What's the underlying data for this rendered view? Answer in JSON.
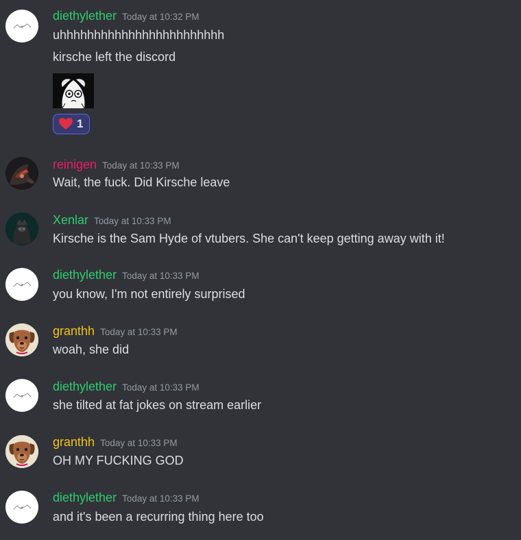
{
  "colors": {
    "background": "#313338",
    "text": "#dbdee1",
    "timestamp": "#949ba4",
    "user_green": "#2ecc71",
    "user_pink": "#e91e63",
    "user_yellow": "#f1c40f",
    "reaction_border": "#5865f2",
    "reaction_bg": "#373a6d"
  },
  "messages": [
    {
      "username": "diethylether",
      "timestamp": "Today at 10:32 PM",
      "avatar": "skeletal-formula-avatar",
      "lines": [
        "uhhhhhhhhhhhhhhhhhhhhhhhh",
        "kirsche left the discord"
      ],
      "attachment": "anime-girl-sketch-image",
      "reaction": {
        "emoji": "heart-emoji",
        "count": "1"
      }
    },
    {
      "username": "reinigen",
      "timestamp": "Today at 10:33 PM",
      "avatar": "dark-character-avatar",
      "lines": [
        "Wait, the fuck. Did Kirsche leave"
      ]
    },
    {
      "username": "Xenlar",
      "timestamp": "Today at 10:33 PM",
      "avatar": "dark-figure-avatar",
      "lines": [
        "Kirsche is the Sam Hyde of vtubers. She can't keep getting away with it!"
      ]
    },
    {
      "username": "diethylether",
      "timestamp": "Today at 10:33 PM",
      "avatar": "skeletal-formula-avatar",
      "lines": [
        "you know, I'm not entirely surprised"
      ]
    },
    {
      "username": "granthh",
      "timestamp": "Today at 10:33 PM",
      "avatar": "dog-avatar",
      "lines": [
        "woah, she did"
      ]
    },
    {
      "username": "diethylether",
      "timestamp": "Today at 10:33 PM",
      "avatar": "skeletal-formula-avatar",
      "lines": [
        "she tilted at fat jokes on stream earlier"
      ]
    },
    {
      "username": "granthh",
      "timestamp": "Today at 10:33 PM",
      "avatar": "dog-avatar",
      "lines": [
        "OH MY FUCKING GOD"
      ]
    },
    {
      "username": "diethylether",
      "timestamp": "Today at 10:33 PM",
      "avatar": "skeletal-formula-avatar",
      "lines": [
        "and it's been a recurring thing here too"
      ]
    }
  ]
}
